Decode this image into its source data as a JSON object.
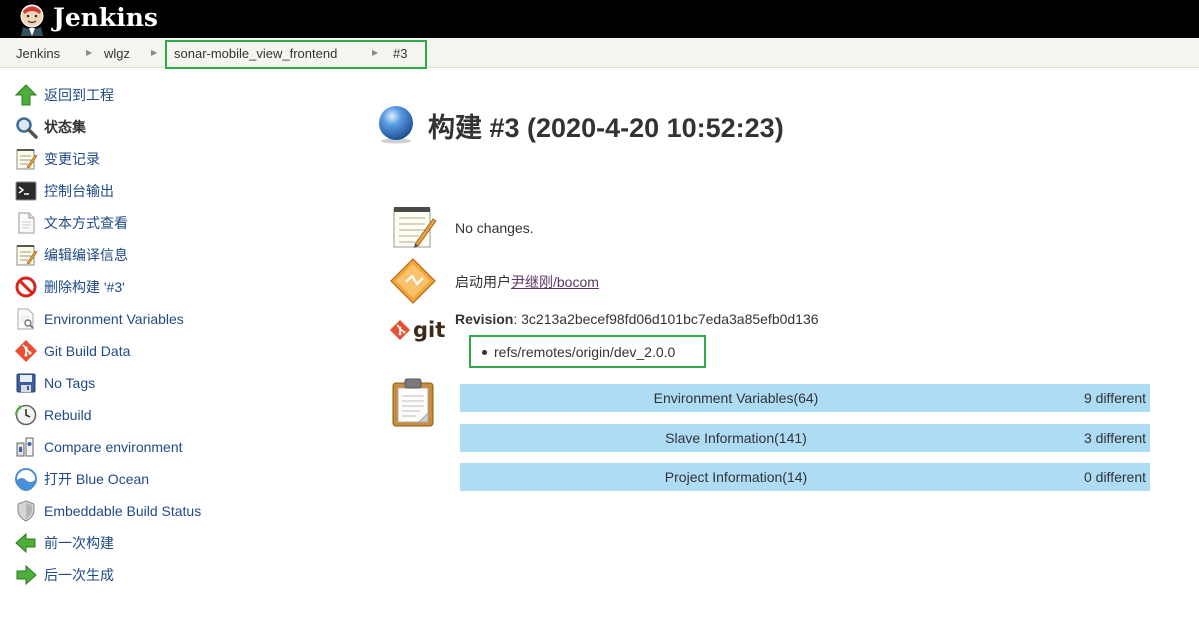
{
  "header": {
    "brand": "Jenkins"
  },
  "breadcrumb": {
    "items": [
      "Jenkins",
      "wlgz",
      "sonar-mobile_view_frontend",
      "#3"
    ]
  },
  "side_tasks": [
    {
      "label": "返回到工程",
      "icon": "up-arrow-icon",
      "bold": false
    },
    {
      "label": "状态集",
      "icon": "magnifier-icon",
      "bold": true
    },
    {
      "label": "变更记录",
      "icon": "notepad-icon",
      "bold": false
    },
    {
      "label": "控制台输出",
      "icon": "terminal-icon",
      "bold": false
    },
    {
      "label": "文本方式查看",
      "icon": "document-icon",
      "bold": false
    },
    {
      "label": "编辑编译信息",
      "icon": "notepad-edit-icon",
      "bold": false
    },
    {
      "label": "删除构建 '#3'",
      "icon": "no-entry-icon",
      "bold": false
    },
    {
      "label": "Environment Variables",
      "icon": "document-search-icon",
      "bold": false
    },
    {
      "label": "Git Build Data",
      "icon": "git-icon",
      "bold": false
    },
    {
      "label": "No Tags",
      "icon": "floppy-icon",
      "bold": false
    },
    {
      "label": "Rebuild",
      "icon": "clock-icon",
      "bold": false
    },
    {
      "label": "Compare environment",
      "icon": "compare-icon",
      "bold": false
    },
    {
      "label": "打开 Blue Ocean",
      "icon": "blue-ocean-icon",
      "bold": false
    },
    {
      "label": "Embeddable Build Status",
      "icon": "shield-icon",
      "bold": false
    },
    {
      "label": "前一次构建",
      "icon": "left-arrow-icon",
      "bold": false
    },
    {
      "label": "后一次生成",
      "icon": "right-arrow-icon",
      "bold": false
    }
  ],
  "build": {
    "title": "构建 #3 (2020-4-20 10:52:23)",
    "changes_text": "No changes.",
    "started_prefix": "启动用户",
    "started_user": "尹继刚/bocom",
    "revision_label": "Revision",
    "revision_sep": ": ",
    "revision_hash": "3c213a2becef98fd06d101bc7eda3a85efb0d136",
    "branch": "refs/remotes/origin/dev_2.0.0",
    "git_logo_text": "git"
  },
  "env_diffs": [
    {
      "name": "Environment Variables(64)",
      "count": "9 different"
    },
    {
      "name": "Slave Information(141)",
      "count": "3 different"
    },
    {
      "name": "Project Information(14)",
      "count": "0 different"
    }
  ],
  "colors": {
    "header_bg": "#000000",
    "highlight_border": "#2eaa4a",
    "diff_row_bg": "#aedcf5",
    "link": "#204a87"
  }
}
